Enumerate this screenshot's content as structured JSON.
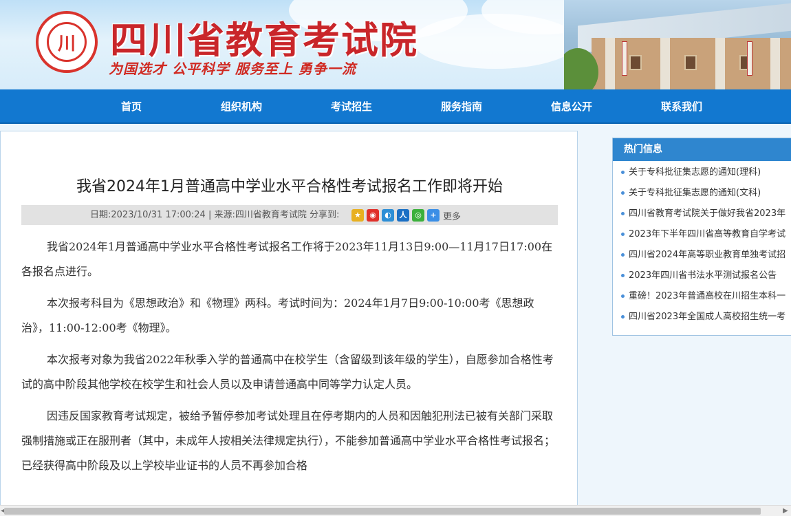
{
  "header": {
    "site_title": "四川省教育考试院",
    "motto": "为国选才  公平科学  服务至上  勇争一流"
  },
  "nav": {
    "items": [
      "首页",
      "组织机构",
      "考试招生",
      "服务指南",
      "信息公开",
      "联系我们"
    ]
  },
  "article": {
    "title": "我省2024年1月普通高中学业水平合格性考试报名工作即将开始",
    "meta": "日期:2023/10/31 17:00:24 | 来源:四川省教育考试院   分享到:",
    "more_label": "更多",
    "paragraphs": [
      "我省2024年1月普通高中学业水平合格性考试报名工作将于2023年11月13日9:00—11月17日17:00在各报名点进行。",
      "本次报考科目为《思想政治》和《物理》两科。考试时间为：2024年1月7日9:00-10:00考《思想政治》，11:00-12:00考《物理》。",
      "本次报考对象为我省2022年秋季入学的普通高中在校学生（含留级到该年级的学生），自愿参加合格性考试的高中阶段其他学校在校学生和社会人员以及申请普通高中同等学力认定人员。",
      "因违反国家教育考试规定，被给予暂停参加考试处理且在停考期内的人员和因触犯刑法已被有关部门采取强制措施或正在服刑者（其中，未成年人按相关法律规定执行），不能参加普通高中学业水平合格性考试报名；已经获得高中阶段及以上学校毕业证书的人员不再参加合格"
    ]
  },
  "sidebar": {
    "heading": "热门信息",
    "items": [
      "关于专科批征集志愿的通知(理科)",
      "关于专科批征集志愿的通知(文科)",
      "四川省教育考试院关于做好我省2023年",
      "2023年下半年四川省高等教育自学考试",
      "四川省2024年高等职业教育单独考试招",
      "2023年四川省书法水平测试报名公告",
      "重磅！2023年普通高校在川招生本科一",
      "四川省2023年全国成人高校招生统一考"
    ]
  },
  "colors": {
    "nav_bg": "#1278d0",
    "title_red": "#c9262a",
    "sidebar_head": "#2f86cf"
  }
}
